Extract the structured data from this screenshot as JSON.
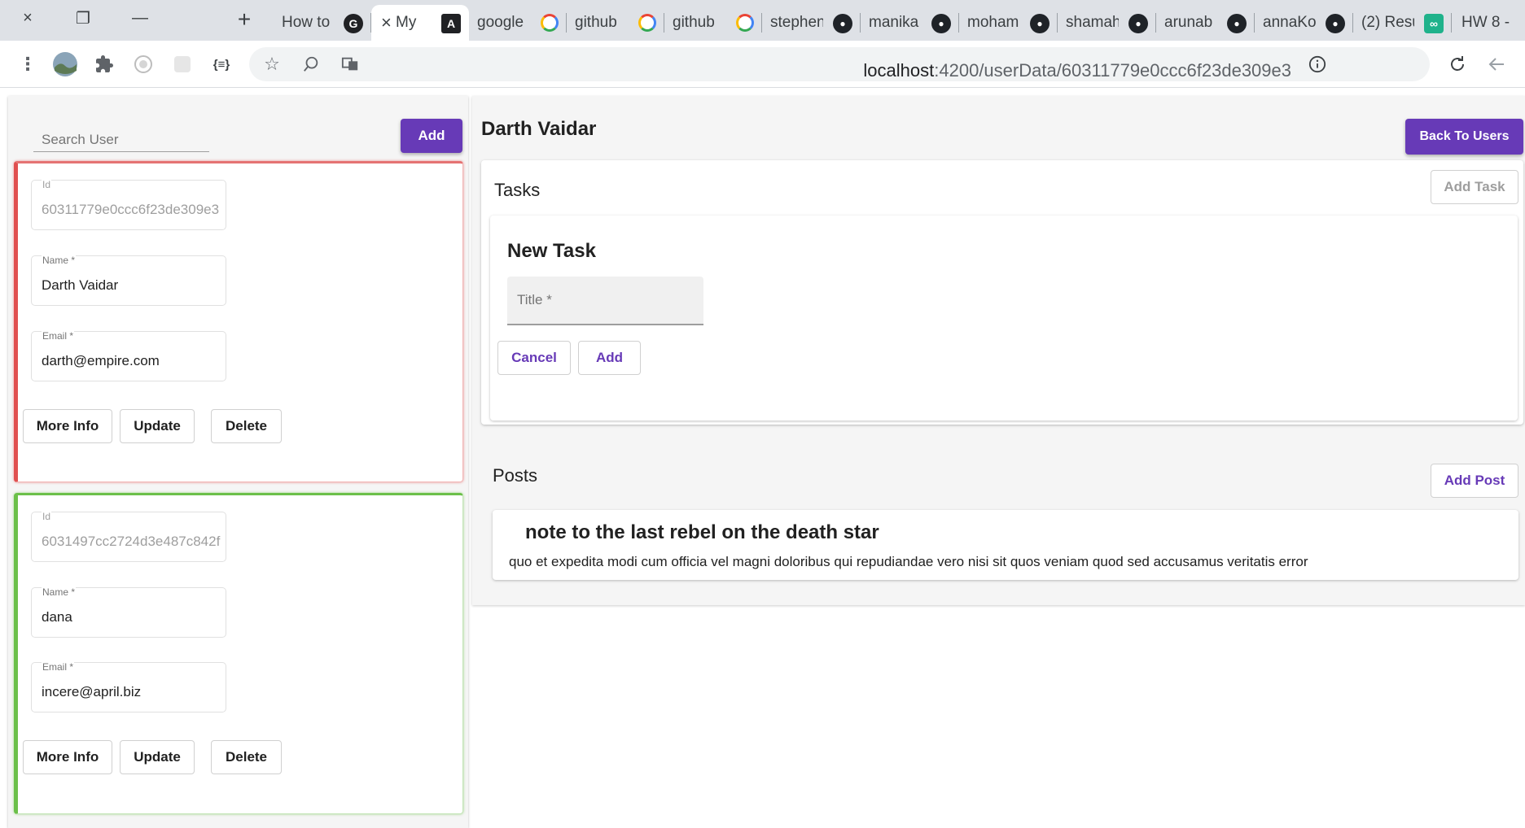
{
  "window": {
    "close_icon": "×",
    "restore_icon": "❐",
    "minimize_icon": "—",
    "new_tab_icon": "+"
  },
  "tabs": [
    {
      "title": "How to",
      "icon": "G",
      "favicon": "dark"
    },
    {
      "title": "My",
      "icon": "A",
      "favicon": "angular",
      "active": true
    },
    {
      "title": "google",
      "icon": "G",
      "favicon": "google"
    },
    {
      "title": "github",
      "icon": "G",
      "favicon": "google"
    },
    {
      "title": "github",
      "icon": "G",
      "favicon": "google"
    },
    {
      "title": "stephen",
      "icon": "gh",
      "favicon": "github"
    },
    {
      "title": "manika",
      "icon": "gh",
      "favicon": "github"
    },
    {
      "title": "moham",
      "icon": "gh",
      "favicon": "github"
    },
    {
      "title": "shamah",
      "icon": "gh",
      "favicon": "github"
    },
    {
      "title": "arunab",
      "icon": "gh",
      "favicon": "github"
    },
    {
      "title": "annaKo",
      "icon": "gh",
      "favicon": "github"
    },
    {
      "title": "(2) Resu",
      "icon": "∞",
      "favicon": "square"
    },
    {
      "title": "HW 8 -",
      "icon": "",
      "favicon": "none"
    }
  ],
  "toolbar": {
    "url_host": "localhost",
    "url_rest": ":4200/userData/60311779e0ccc6f23de309e3"
  },
  "left": {
    "search_placeholder": "Search User",
    "add_button": "Add",
    "users": [
      {
        "id_label": "Id",
        "id": "60311779e0ccc6f23de309e3",
        "name_label": "Name *",
        "name": "Darth Vaidar",
        "email_label": "Email *",
        "email": "darth@empire.com",
        "more_info": "More Info",
        "update": "Update",
        "delete": "Delete",
        "status_color": "#e05050"
      },
      {
        "id_label": "Id",
        "id": "6031497cc2724d3e487c842f",
        "name_label": "Name *",
        "name": "dana",
        "email_label": "Email *",
        "email": "incere@april.biz",
        "more_info": "More Info",
        "update": "Update",
        "delete": "Delete",
        "status_color": "#6cc04a"
      }
    ]
  },
  "right": {
    "user_name": "Darth Vaidar",
    "back_button": "Back To Users",
    "tasks": {
      "title": "Tasks",
      "add_task": "Add Task",
      "new_task_title": "New Task",
      "title_placeholder": "Title *",
      "cancel": "Cancel",
      "add": "Add"
    },
    "posts": {
      "title": "Posts",
      "add_post": "Add Post",
      "items": [
        {
          "title": "note to the last rebel on the death star",
          "body": "quo et expedita modi cum officia vel magni doloribus qui repudiandae vero nisi sit quos veniam quod sed accusamus veritatis error"
        }
      ]
    }
  },
  "colors": {
    "primary": "#673ab7",
    "chrome_bg": "#dee1e6"
  }
}
